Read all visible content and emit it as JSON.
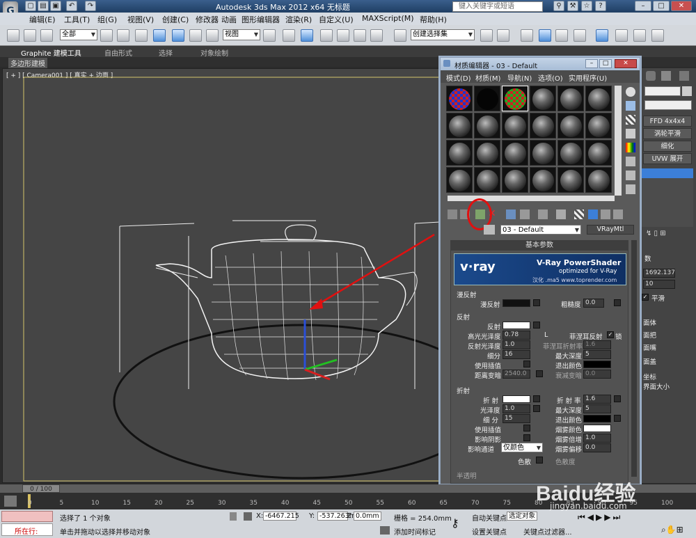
{
  "window": {
    "title": "Autodesk 3ds Max  2012 x64       无标题",
    "search_placeholder": "键入关键字或短语"
  },
  "menubar": {
    "items": [
      "编辑(E)",
      "工具(T)",
      "组(G)",
      "视图(V)",
      "创建(C)",
      "修改器",
      "动画",
      "图形编辑器",
      "渲染(R)",
      "自定义(U)",
      "MAXScript(M)",
      "帮助(H)"
    ]
  },
  "toolbar": {
    "filter_value": "全部",
    "refcoord_value": "视图",
    "named_sel_value": "创建选择集"
  },
  "ribbon": {
    "tabs": [
      "Graphite 建模工具",
      "自由形式",
      "选择",
      "对象绘制"
    ],
    "sub": "多边形建模"
  },
  "viewport": {
    "label": "[ + ] [ Camera001 ] [ 真实 + 边面 ]"
  },
  "right_panel": {
    "modifiers": [
      "FFD 4x4x4",
      "涡轮平滑",
      "细化",
      "UVW 展开"
    ],
    "field1": "1692.137",
    "field2": "10",
    "smooth_label": "平滑",
    "params_label": "数",
    "items": [
      "面体",
      "面把",
      "面嘴",
      "面盖"
    ],
    "mapping": "坐标",
    "real_world": "界面大小"
  },
  "material_editor": {
    "title": "材质编辑器 - 03 - Default",
    "menu": [
      "模式(D)",
      "材质(M)",
      "导航(N)",
      "选项(O)",
      "实用程序(U)"
    ],
    "material_name": "03 - Default",
    "material_type": "VRayMtl",
    "rollout_basic": "基本参数",
    "vray_banner_title": "V-Ray PowerShader",
    "vray_banner_sub": "optimized for V-Ray",
    "vray_banner_credit": "汉化 .ma5 www.toprender.com",
    "vray_logo": "v·ray",
    "diffuse": {
      "group": "漫反射",
      "diffuse_label": "漫反射",
      "roughness_label": "粗糙度",
      "roughness_value": "0.0"
    },
    "reflection": {
      "group": "反射",
      "reflect_label": "反射",
      "hilight_gloss_label": "高光光泽度",
      "hilight_gloss_value": "0.78",
      "lock_label": "L",
      "fresnel_label": "菲涅耳反射",
      "refl_gloss_label": "反射光泽度",
      "refl_gloss_value": "1.0",
      "fresnel_ior_label": "菲涅耳折射率",
      "fresnel_ior_value": "1.6",
      "subdivs_label": "细分",
      "subdivs_value": "16",
      "max_depth_label": "最大深度",
      "max_depth_value": "5",
      "use_interp_label": "使用插值",
      "exit_color_label": "退出颜色",
      "dim_dist_label": "距离变暗",
      "dim_dist_value": "2540.0",
      "dim_falloff_label": "衰减变暗",
      "dim_falloff_value": "0.0",
      "lock_text": "锁"
    },
    "refraction": {
      "group": "折射",
      "refract_label": "折 射",
      "ior_label": "折 射 率",
      "ior_value": "1.6",
      "gloss_label": "光泽度",
      "gloss_value": "1.0",
      "max_depth_label": "最大深度",
      "max_depth_value": "5",
      "subdivs_label": "细 分",
      "subdivs_value": "15",
      "exit_color_label": "退出颜色",
      "use_interp_label": "使用插值",
      "fog_color_label": "烟雾颜色",
      "affect_shadows_label": "影响阴影",
      "fog_mult_label": "烟雾倍增",
      "fog_mult_value": "1.0",
      "affect_channels_label": "影响通道",
      "affect_channels_value": "仅颜色",
      "fog_bias_label": "烟雾偏移",
      "fog_bias_value": "0.0",
      "dispersion_label": "色散",
      "abbe_label": "色散度",
      "translucency_label": "半透明"
    }
  },
  "timeline": {
    "position": "0 / 100",
    "ticks": [
      "0",
      "5",
      "10",
      "15",
      "20",
      "25",
      "30",
      "35",
      "40",
      "45",
      "50",
      "55",
      "60",
      "65",
      "70",
      "75",
      "80",
      "85",
      "90",
      "95",
      "100"
    ]
  },
  "status": {
    "mode": "所在行:",
    "selected": "选择了 1 个对象",
    "prompt": "单击并拖动以选择并移动对象",
    "x_label": "X:",
    "x_value": "-6467.215",
    "y_label": "Y:",
    "y_value": "-537.263m",
    "z_label": "Z:",
    "z_value": "0.0mm",
    "grid": "栅格 = 254.0mm",
    "add_time_tag": "添加时间标记",
    "auto_key": "自动关键点",
    "auto_key_value": "选定对象",
    "set_key": "设置关键点",
    "key_filters": "关键点过滤器..."
  },
  "watermark": {
    "text": "Baidu经验",
    "url": "jingyan.baidu.com"
  },
  "colors": {
    "annotation": "#e01010",
    "selection_blue": "#3c7fd8"
  }
}
